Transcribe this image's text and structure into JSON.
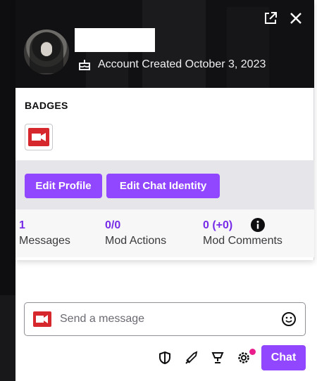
{
  "header": {
    "account_created": "Account Created October 3, 2023"
  },
  "badges": {
    "title": "BADGES",
    "items": [
      {
        "icon": "video-camera-badge-icon",
        "color": "#d6272d"
      }
    ]
  },
  "actions": {
    "edit_profile": "Edit Profile",
    "edit_chat_identity": "Edit Chat Identity"
  },
  "stats": [
    {
      "value": "1",
      "label": "Messages"
    },
    {
      "value": "0/0",
      "label": "Mod Actions"
    },
    {
      "value": "0 (+0)",
      "label": "Mod Comments"
    }
  ],
  "chat": {
    "placeholder": "Send a message",
    "send_label": "Chat"
  },
  "colors": {
    "accent": "#9147ff",
    "accent_text": "#772ce8",
    "badge_red": "#d6272d",
    "notification_dot": "#e91e8c"
  }
}
